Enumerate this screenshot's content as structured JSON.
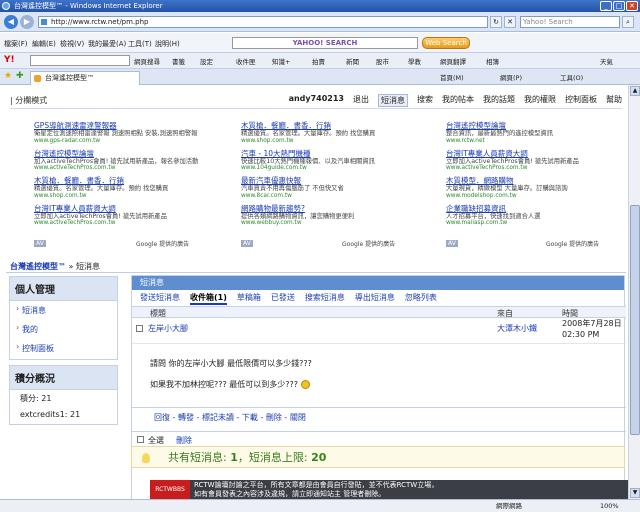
{
  "browser": {
    "title": "台灣遙控模型™ - Windows Internet Explorer",
    "url": "http://www.rctw.net/pm.php",
    "search_placeholder": "Yahoo! Search",
    "menu": [
      "檔案(F)",
      "編輯(E)",
      "檢視(V)",
      "我的最愛(A)",
      "工具(T)",
      "說明(H)"
    ],
    "yahoo_search_label": "YAHOO! SEARCH",
    "web_search_label": "Web Search",
    "yahoo_toolbar": [
      "網頁搜尋",
      "書籤",
      "設定",
      "收件匣",
      "知識+",
      "拍賣",
      "新聞",
      "股市",
      "學教",
      "網頁翻譯",
      "相簿",
      "天氣"
    ],
    "tab_title": "台灣遙控模型™",
    "tab_tools": [
      "首頁(M)",
      "網頁(P)",
      "工具(O)"
    ],
    "status": "網際網路",
    "zoom": "100%"
  },
  "topnav": {
    "left": "| 分欄模式",
    "user": "andy740213",
    "links": [
      "退出",
      "短消息",
      "搜索",
      "我的帖本",
      "我的話題",
      "我的權限",
      "控制面板",
      "幫助"
    ],
    "active": "短消息"
  },
  "ads": {
    "columns": [
      [
        {
          "title": "GPS導航測速雷達警報器",
          "desc": "衛星定位測速照相雷達警報 測速照相點 安裝,測速照相警報",
          "url": "www.gps-radar.com.tw"
        },
        {
          "title": "台灣遙控模型論壇",
          "desc": "加入activeTechPros會員! 搶先試用新產品，報名參加活動",
          "url": "www.activeTechPros.com.tw"
        },
        {
          "title": "木質槍．餐廳．書香．行銷",
          "desc": "精選優質。名家管理。大量庫存。預約 找您購買",
          "url": "www.shop.com.tw"
        },
        {
          "title": "台灣IT專業人員薪資大調",
          "desc": "立即加入activeTechPros會員! 搶先試用新產品",
          "url": "www.activeTechPros.com.tw"
        }
      ],
      [
        {
          "title": "木質槍．餐廳．書香．行銷",
          "desc": "精選優質。名家管理。大量庫存。預約 找您購買",
          "url": "www.shop.com.tw"
        },
        {
          "title": "汽車 - 10大熱門機種",
          "desc": "快速比較10大熱門機種報價、以及汽車相關資訊",
          "url": "www.104guide.com.tw"
        },
        {
          "title": "最新汽車優惠快報",
          "desc": "汽車買賣不用再傷腦筋了 不但快又省",
          "url": "www.8car.com.tw"
        },
        {
          "title": "網路購物最新趨勢?",
          "desc": "提供各類網路購物資訊，讓您購物更便利",
          "url": "www.webbuy.com.tw"
        }
      ],
      [
        {
          "title": "台灣遙控模型論壇",
          "desc": "整合資訊，最新最熱門的遙控模型資訊",
          "url": "www.rctw.net"
        },
        {
          "title": "台灣IT專業人員薪資大調",
          "desc": "立即加入activeTechPros會員! 搶先試用新產品",
          "url": "www.activeTechPros.com.tw"
        },
        {
          "title": "木質模型．網路購物",
          "desc": "大量現貨，精緻模型 大量庫存。訂購與諮詢",
          "url": "www.modelshop.com.tw"
        },
        {
          "title": "企業職缺招募資訊",
          "desc": "人才招募平台，快速找到適合人選",
          "url": "www.mailasp.com.tw"
        }
      ]
    ],
    "footer_label": "Google 提供的廣告",
    "ad_badge": "AV"
  },
  "breadcrumb": {
    "site": "台灣遙控模型™",
    "page": "短消息"
  },
  "sidebar": {
    "personal": {
      "title": "個人管理",
      "items": [
        "短消息",
        "我的",
        "控制面板"
      ]
    },
    "points": {
      "title": "積分概況",
      "stats": [
        "積分: 21",
        "extcredits1: 21"
      ]
    }
  },
  "main": {
    "header": "短消息",
    "tabs": [
      "發送短消息",
      "收件箱(1)",
      "草稿箱",
      "已發送",
      "搜索短消息",
      "導出短消息",
      "忽略列表"
    ],
    "selected_tab": "收件箱(1)",
    "columns": {
      "title": "標題",
      "from": "來自",
      "time": "時間"
    },
    "message": {
      "subject": "左岸小大腳",
      "from": "大潭木小鐵",
      "date": "2008年7月28日",
      "time": "02:30 PM",
      "body_line1": "請問 你的左岸小大腳 最低限價可以多少錢???",
      "body_line2": "如果我不加林控呢??? 最低可以到多少???"
    },
    "actions": "回復 - 轉發 - 標記未讀 - 下載 - 刪除 - 關閉",
    "select_all": "全選",
    "delete": "刪除"
  },
  "counts": {
    "prefix": "共有短消息: ",
    "total": "1",
    "mid": "，短消息上限: ",
    "limit": "20"
  },
  "banner": {
    "logo": "RCTWBBS",
    "text1": "RCTW論壇討論之平台，所有文章都是由會員自行發貼，並不代表RCTW立場，",
    "text2": "如有會員發表之內容涉及違規，請立即通知站主 管理者刪除。"
  }
}
